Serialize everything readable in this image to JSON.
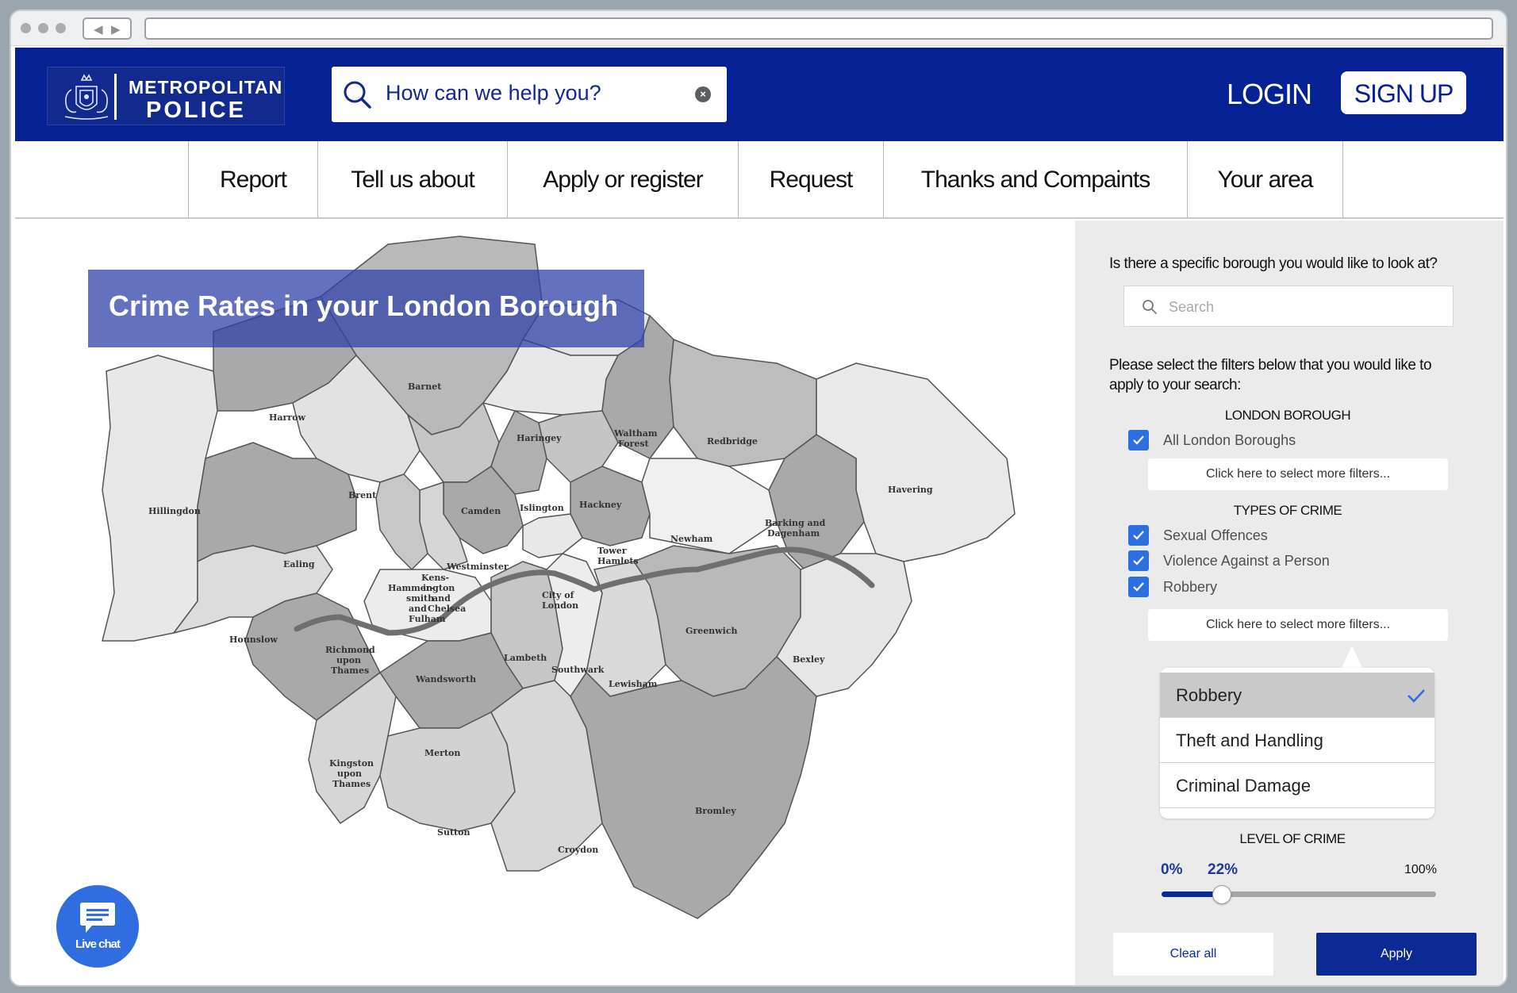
{
  "header": {
    "logo_line1": "METROPOLITAN",
    "logo_line2": "POLICE",
    "search_text": "How can we help you?",
    "login": "LOGIN",
    "signup": "SIGN UP",
    "brand_color": "#052193"
  },
  "nav": {
    "items": [
      {
        "label": "Report"
      },
      {
        "label": "Tell us about"
      },
      {
        "label": "Apply or register"
      },
      {
        "label": "Request"
      },
      {
        "label": "Thanks and Compaints"
      },
      {
        "label": "Your area"
      }
    ]
  },
  "map": {
    "title": "Crime Rates in your London Borough",
    "boroughs": [
      "Barnet",
      "Harrow",
      "Haringey",
      "Waltham Forest",
      "Redbridge",
      "Havering",
      "Hillingdon",
      "Brent",
      "Camden",
      "Islington",
      "Hackney",
      "Barking and Dagenham",
      "Ealing",
      "Westminster",
      "Tower Hamlets",
      "Newham",
      "Kens-ington and Chelsea",
      "Hammer-smith and Fulham",
      "City of London",
      "Hounslow",
      "Richmond upon Thames",
      "Wandsworth",
      "Lambeth",
      "Southwark",
      "Lewisham",
      "Greenwich",
      "Bexley",
      "Kingston upon Thames",
      "Merton",
      "Sutton",
      "Croydon",
      "Bromley"
    ]
  },
  "live_chat": {
    "label": "Live chat"
  },
  "panel": {
    "borough_question": "Is there a specific borough you would like  to look at?",
    "search_placeholder": "Search",
    "filters_prompt": "Please select the filters below that you would like to apply to your search:",
    "borough_heading": "LONDON BOROUGH",
    "borough_options": [
      {
        "label": "All London Boroughs",
        "checked": true
      }
    ],
    "more_filters_label": "Click here to select more filters...",
    "crime_heading": "TYPES OF CRIME",
    "crime_options": [
      {
        "label": "Sexual Offences",
        "checked": true
      },
      {
        "label": "Violence Against a Person",
        "checked": true
      },
      {
        "label": "Robbery",
        "checked": true
      }
    ],
    "dropdown_items": [
      {
        "label": "Robbery",
        "selected": true
      },
      {
        "label": "Theft and Handling",
        "selected": false
      },
      {
        "label": "Criminal Damage",
        "selected": false
      }
    ],
    "level_heading": "LEVEL OF CRIME",
    "level_min_label": "0%",
    "level_value_label": "22%",
    "level_max_label": "100%",
    "level_value": 0.22,
    "clear_label": "Clear all",
    "apply_label": "Apply",
    "accent_color": "#2b6fe0"
  }
}
